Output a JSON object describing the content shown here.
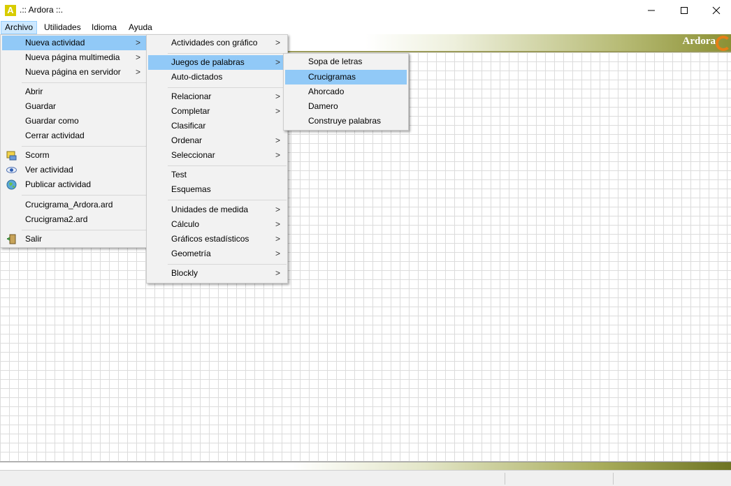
{
  "window": {
    "title": ".:: Ardora ::.",
    "app_icon_letter": "A"
  },
  "menubar": [
    {
      "label": "Archivo",
      "active": true
    },
    {
      "label": "Utilidades"
    },
    {
      "label": "Idioma"
    },
    {
      "label": "Ayuda"
    }
  ],
  "brand": {
    "name": "Ardora"
  },
  "archivo_menu": {
    "items": [
      {
        "label": "Nueva actividad",
        "submenu": true,
        "highlighted": true
      },
      {
        "label": "Nueva página multimedia",
        "submenu": true
      },
      {
        "label": "Nueva página en servidor",
        "submenu": true
      },
      {
        "label": "Abrir"
      },
      {
        "label": "Guardar"
      },
      {
        "label": "Guardar como"
      },
      {
        "label": "Cerrar actividad"
      },
      {
        "label": "Scorm",
        "icon": "scorm-icon"
      },
      {
        "label": "Ver actividad",
        "icon": "eye-icon"
      },
      {
        "label": "Publicar actividad",
        "icon": "globe-icon"
      },
      {
        "label": "Crucigrama_Ardora.ard"
      },
      {
        "label": "Crucigrama2.ard"
      },
      {
        "label": "Salir",
        "icon": "exit-door-icon"
      }
    ]
  },
  "nueva_actividad_menu": {
    "items": [
      {
        "label": "Actividades con gráfico",
        "submenu": true
      },
      {
        "label": "Juegos de palabras",
        "submenu": true,
        "highlighted": true
      },
      {
        "label": "Auto-dictados"
      },
      {
        "label": "Relacionar",
        "submenu": true
      },
      {
        "label": "Completar",
        "submenu": true
      },
      {
        "label": "Clasificar"
      },
      {
        "label": "Ordenar",
        "submenu": true
      },
      {
        "label": "Seleccionar",
        "submenu": true
      },
      {
        "label": "Test"
      },
      {
        "label": "Esquemas"
      },
      {
        "label": "Unidades de medida",
        "submenu": true
      },
      {
        "label": "Cálculo",
        "submenu": true
      },
      {
        "label": "Gráficos estadísticos",
        "submenu": true
      },
      {
        "label": "Geometría",
        "submenu": true
      },
      {
        "label": "Blockly",
        "submenu": true
      }
    ]
  },
  "juegos_menu": {
    "items": [
      {
        "label": "Sopa de letras"
      },
      {
        "label": "Crucigramas",
        "highlighted": true
      },
      {
        "label": "Ahorcado"
      },
      {
        "label": "Damero"
      },
      {
        "label": "Construye palabras"
      }
    ]
  },
  "colors": {
    "highlight": "#91c9f7",
    "menu_bg": "#f2f2f2",
    "accent_olive": "#8b9034",
    "accent_orange": "#e57f17"
  }
}
